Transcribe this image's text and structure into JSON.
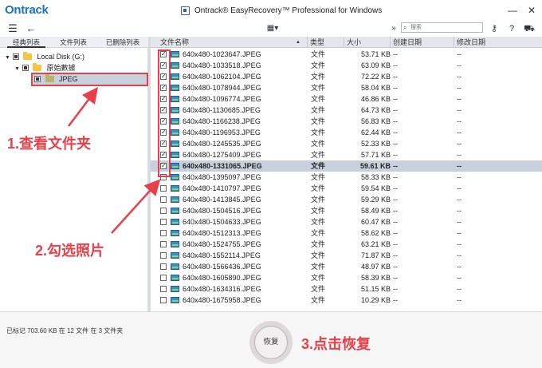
{
  "titlebar": {
    "logo": "Ontrack",
    "title": "Ontrack® EasyRecovery™ Professional for Windows",
    "minimize": "—",
    "close": "✕"
  },
  "toolbar": {
    "search_placeholder": "搜索"
  },
  "left_panel": {
    "tabs": [
      "经典列表",
      "文件列表",
      "已删除列表"
    ],
    "tree": [
      {
        "label": "Local Disk (G:)"
      },
      {
        "label": "原始數據"
      },
      {
        "label": "JPEG"
      }
    ]
  },
  "table": {
    "columns": [
      "文件名称",
      "类型",
      "大小",
      "创建日期",
      "修改日期"
    ],
    "rows": [
      {
        "name": "640x480-1023647.JPEG",
        "type": "文件",
        "size": "53.71 KB",
        "created": "--",
        "modified": "--",
        "checked": true
      },
      {
        "name": "640x480-1033518.JPEG",
        "type": "文件",
        "size": "63.09 KB",
        "created": "--",
        "modified": "--",
        "checked": true
      },
      {
        "name": "640x480-1062104.JPEG",
        "type": "文件",
        "size": "72.22 KB",
        "created": "--",
        "modified": "--",
        "checked": true
      },
      {
        "name": "640x480-1078944.JPEG",
        "type": "文件",
        "size": "58.04 KB",
        "created": "--",
        "modified": "--",
        "checked": true
      },
      {
        "name": "640x480-1096774.JPEG",
        "type": "文件",
        "size": "46.86 KB",
        "created": "--",
        "modified": "--",
        "checked": true
      },
      {
        "name": "640x480-1130685.JPEG",
        "type": "文件",
        "size": "64.73 KB",
        "created": "--",
        "modified": "--",
        "checked": true
      },
      {
        "name": "640x480-1166238.JPEG",
        "type": "文件",
        "size": "56.83 KB",
        "created": "--",
        "modified": "--",
        "checked": true
      },
      {
        "name": "640x480-1196953.JPEG",
        "type": "文件",
        "size": "62.44 KB",
        "created": "--",
        "modified": "--",
        "checked": true
      },
      {
        "name": "640x480-1245535.JPEG",
        "type": "文件",
        "size": "52.33 KB",
        "created": "--",
        "modified": "--",
        "checked": true
      },
      {
        "name": "640x480-1275409.JPEG",
        "type": "文件",
        "size": "57.71 KB",
        "created": "--",
        "modified": "--",
        "checked": true
      },
      {
        "name": "640x480-1331065.JPEG",
        "type": "文件",
        "size": "59.61 KB",
        "created": "--",
        "modified": "--",
        "checked": true,
        "selected": true
      },
      {
        "name": "640x480-1395097.JPEG",
        "type": "文件",
        "size": "58.33 KB",
        "created": "--",
        "modified": "--",
        "checked": false
      },
      {
        "name": "640x480-1410797.JPEG",
        "type": "文件",
        "size": "59.54 KB",
        "created": "--",
        "modified": "--",
        "checked": false
      },
      {
        "name": "640x480-1413845.JPEG",
        "type": "文件",
        "size": "59.29 KB",
        "created": "--",
        "modified": "--",
        "checked": false
      },
      {
        "name": "640x480-1504516.JPEG",
        "type": "文件",
        "size": "58.49 KB",
        "created": "--",
        "modified": "--",
        "checked": false
      },
      {
        "name": "640x480-1504633.JPEG",
        "type": "文件",
        "size": "60.47 KB",
        "created": "--",
        "modified": "--",
        "checked": false
      },
      {
        "name": "640x480-1512313.JPEG",
        "type": "文件",
        "size": "58.62 KB",
        "created": "--",
        "modified": "--",
        "checked": false
      },
      {
        "name": "640x480-1524755.JPEG",
        "type": "文件",
        "size": "63.21 KB",
        "created": "--",
        "modified": "--",
        "checked": false
      },
      {
        "name": "640x480-1552114.JPEG",
        "type": "文件",
        "size": "71.87 KB",
        "created": "--",
        "modified": "--",
        "checked": false
      },
      {
        "name": "640x480-1566436.JPEG",
        "type": "文件",
        "size": "48.97 KB",
        "created": "--",
        "modified": "--",
        "checked": false
      },
      {
        "name": "640x480-1605890.JPEG",
        "type": "文件",
        "size": "58.39 KB",
        "created": "--",
        "modified": "--",
        "checked": false
      },
      {
        "name": "640x480-1634316.JPEG",
        "type": "文件",
        "size": "51.15 KB",
        "created": "--",
        "modified": "--",
        "checked": false
      },
      {
        "name": "640x480-1675958.JPEG",
        "type": "文件",
        "size": "10.29 KB",
        "created": "--",
        "modified": "--",
        "checked": false
      }
    ]
  },
  "status_text": "已标记 703.60 KB 在 12 文件 在 3 文件夹",
  "recover_label": "恢复",
  "annotations": {
    "step1": "1.查看文件夹",
    "step2": "2.勾选照片",
    "step3": "3.点击恢复"
  },
  "colors": {
    "brand": "#1a73c8",
    "annotation": "#e8404a",
    "selection": "#c7d1de"
  }
}
